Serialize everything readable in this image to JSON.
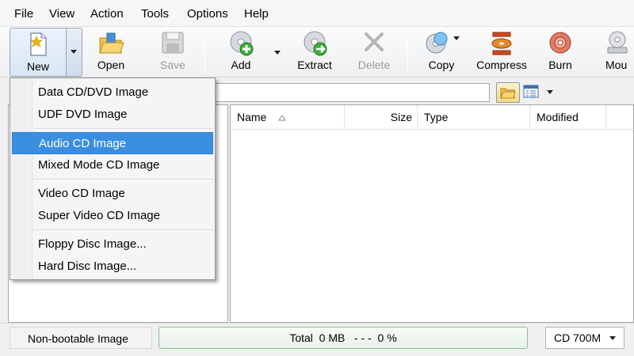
{
  "menubar": {
    "items": [
      {
        "label": "File"
      },
      {
        "label": "View"
      },
      {
        "label": "Action"
      },
      {
        "label": "Tools"
      },
      {
        "label": "Options"
      },
      {
        "label": "Help"
      }
    ]
  },
  "toolbar": {
    "new_label": "New",
    "open_label": "Open",
    "save_label": "Save",
    "add_label": "Add",
    "extract_label": "Extract",
    "delete_label": "Delete",
    "copy_label": "Copy",
    "compress_label": "Compress",
    "burn_label": "Burn",
    "mount_label": "Mou"
  },
  "new_menu": {
    "items": [
      {
        "label": "Data CD/DVD Image"
      },
      {
        "label": "UDF DVD Image"
      },
      {
        "label": "Audio CD Image",
        "selected": true
      },
      {
        "label": "Mixed Mode CD Image"
      },
      {
        "label": "Video CD Image"
      },
      {
        "label": "Super Video CD Image"
      },
      {
        "label": "Floppy Disc Image..."
      },
      {
        "label": "Hard Disc Image..."
      }
    ]
  },
  "file_list": {
    "columns": [
      "Name",
      "Size",
      "Type",
      "Modified"
    ],
    "sort_column": "Name",
    "rows": []
  },
  "statusbar": {
    "boot_status": "Non-bootable Image",
    "total_text": "Total  0 MB   - - -  0 %",
    "disk_size": "CD 700M"
  },
  "colors": {
    "menu_highlight": "#3a8ee0",
    "progress_border": "#8fbf94"
  }
}
